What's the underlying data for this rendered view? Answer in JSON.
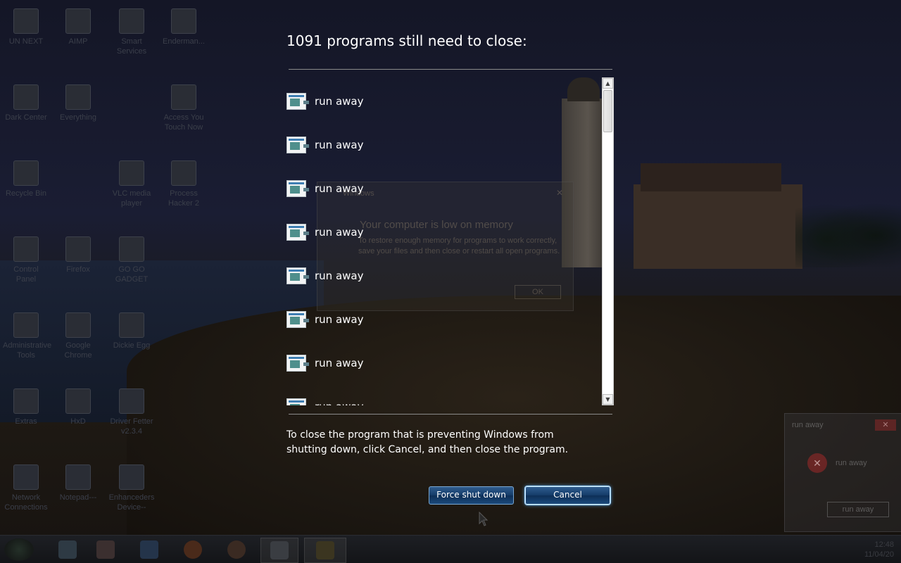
{
  "desktop": {
    "icons": [
      {
        "label": "UN NEXT"
      },
      {
        "label": "AIMP"
      },
      {
        "label": "Smart Services"
      },
      {
        "label": "Enderman..."
      },
      {
        "label": "Dark Center"
      },
      {
        "label": "Everything"
      },
      {
        "label": "Access You Touch Now"
      },
      {
        "label": "Recycle Bin"
      },
      {
        "label": "VLC media player"
      },
      {
        "label": "Process Hacker 2"
      },
      {
        "label": "Control Panel"
      },
      {
        "label": "Firefox"
      },
      {
        "label": "GO GO GADGET"
      },
      {
        "label": "Administrative Tools"
      },
      {
        "label": "Google Chrome"
      },
      {
        "label": "Dickie Egg"
      },
      {
        "label": "Extras"
      },
      {
        "label": "HxD"
      },
      {
        "label": "Driver Fetter v2.3.4"
      },
      {
        "label": "Network Connections"
      },
      {
        "label": "Notepad---"
      },
      {
        "label": "Enhanceders Device--"
      }
    ]
  },
  "memory_dialog": {
    "caption": "Windows",
    "title": "Your computer is low on memory",
    "body": "To restore enough memory for programs to work correctly, save your files and then close or restart all open programs.",
    "ok_label": "OK"
  },
  "runaway_box": {
    "title": "run away",
    "close_label": "✕",
    "message": "run away",
    "button_label": "run away"
  },
  "shutdown": {
    "heading": "1091 programs still need to close:",
    "programs": [
      {
        "label": "run away"
      },
      {
        "label": "run away"
      },
      {
        "label": "run away"
      },
      {
        "label": "run away"
      },
      {
        "label": "run away"
      },
      {
        "label": "run away"
      },
      {
        "label": "run away"
      },
      {
        "label": "run away"
      }
    ],
    "info": "To close the program that is preventing Windows from shutting down, click Cancel, and then close the program.",
    "force_label": "Force shut down",
    "cancel_label": "Cancel"
  },
  "taskbar": {
    "tray_time": "12:48",
    "tray_date": "11/04/20"
  },
  "colors": {
    "accent": "#1b4a7c",
    "text": "#ffffff"
  }
}
